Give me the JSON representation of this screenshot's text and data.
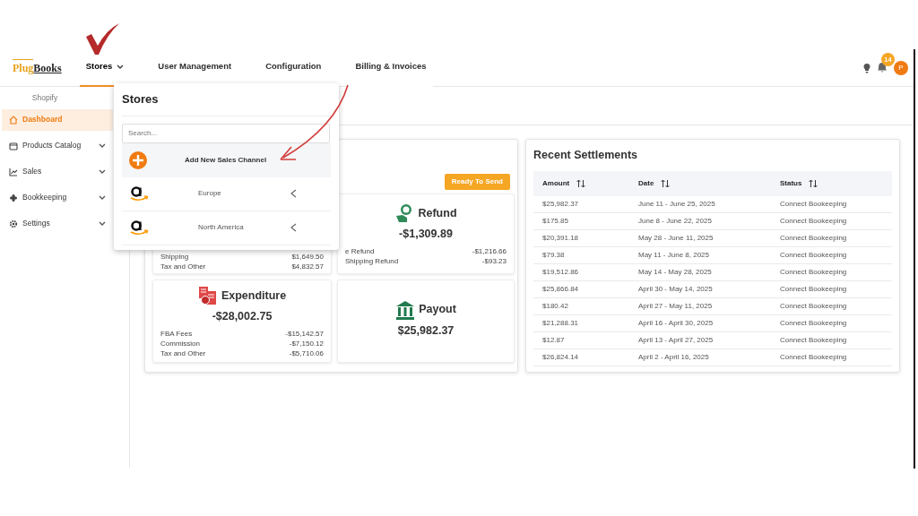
{
  "logo": {
    "first": "Plug",
    "second": "Books"
  },
  "nav": [
    {
      "label": "Stores",
      "selected": true,
      "dropdown": true
    },
    {
      "label": "User Management",
      "selected": false,
      "dropdown": false
    },
    {
      "label": "Configuration",
      "selected": false,
      "dropdown": false
    },
    {
      "label": "Billing & Invoices",
      "selected": false,
      "dropdown": false
    }
  ],
  "notifications": {
    "count": "14"
  },
  "avatar": {
    "initial": "P"
  },
  "sidebar": {
    "heading": "Shopify",
    "items": [
      {
        "label": "Dashboard",
        "selected": true,
        "expandable": false
      },
      {
        "label": "Products Catalog",
        "selected": false,
        "expandable": true
      },
      {
        "label": "Sales",
        "selected": false,
        "expandable": true
      },
      {
        "label": "Bookkeeping",
        "selected": false,
        "expandable": true
      },
      {
        "label": "Settings",
        "selected": false,
        "expandable": true
      }
    ]
  },
  "stores_menu": {
    "title": "Stores",
    "search": {
      "placeholder": "Search..."
    },
    "add_label": "Add New Sales Channel",
    "stores": [
      {
        "name": "Europe"
      },
      {
        "name": "North America"
      }
    ]
  },
  "summary": {
    "status_badge": "Ready To Send",
    "revenue": {
      "rows": [
        {
          "label": "Shipping",
          "value": "$1,649.50"
        },
        {
          "label": "Tax and Other",
          "value": "$4,832.57"
        }
      ]
    },
    "refund": {
      "title": "Refund",
      "amount": "-$1,309.89",
      "rows": [
        {
          "label": "e Refund",
          "value": "-$1,216.66"
        },
        {
          "label": "Shipping Refund",
          "value": "-$93.23"
        }
      ]
    },
    "expenditure": {
      "title": "Expenditure",
      "amount": "-$28,002.75",
      "rows": [
        {
          "label": "FBA Fees",
          "value": "-$15,142.57"
        },
        {
          "label": "Commission",
          "value": "-$7,150.12"
        },
        {
          "label": "Tax and Other",
          "value": "-$5,710.06"
        }
      ]
    },
    "payout": {
      "title": "Payout",
      "amount": "$25,982.37"
    }
  },
  "settlements": {
    "title": "Recent Settlements",
    "columns": [
      "Amount",
      "Date",
      "Status"
    ],
    "rows": [
      [
        "$25,982.37",
        "June 11 - June 25, 2025",
        "Connect Bookeeping"
      ],
      [
        "$175.85",
        "June 8 - June 22, 2025",
        "Connect Bookeeping"
      ],
      [
        "$20,391.18",
        "May 28 - June 11, 2025",
        "Connect Bookeeping"
      ],
      [
        "$79.38",
        "May 11 - June 8, 2025",
        "Connect Bookeeping"
      ],
      [
        "$19,512.86",
        "May 14 - May 28, 2025",
        "Connect Bookeeping"
      ],
      [
        "$25,866.84",
        "April 30 - May 14, 2025",
        "Connect Bookeeping"
      ],
      [
        "$180.42",
        "April 27 - May 11, 2025",
        "Connect Bookeeping"
      ],
      [
        "$21,288.31",
        "April 16 - April 30, 2025",
        "Connect Bookeeping"
      ],
      [
        "$12.87",
        "April 13 - April 27, 2025",
        "Connect Bookeeping"
      ],
      [
        "$26,824.14",
        "April 2 - April 16, 2025",
        "Connect Bookeeping"
      ]
    ]
  }
}
